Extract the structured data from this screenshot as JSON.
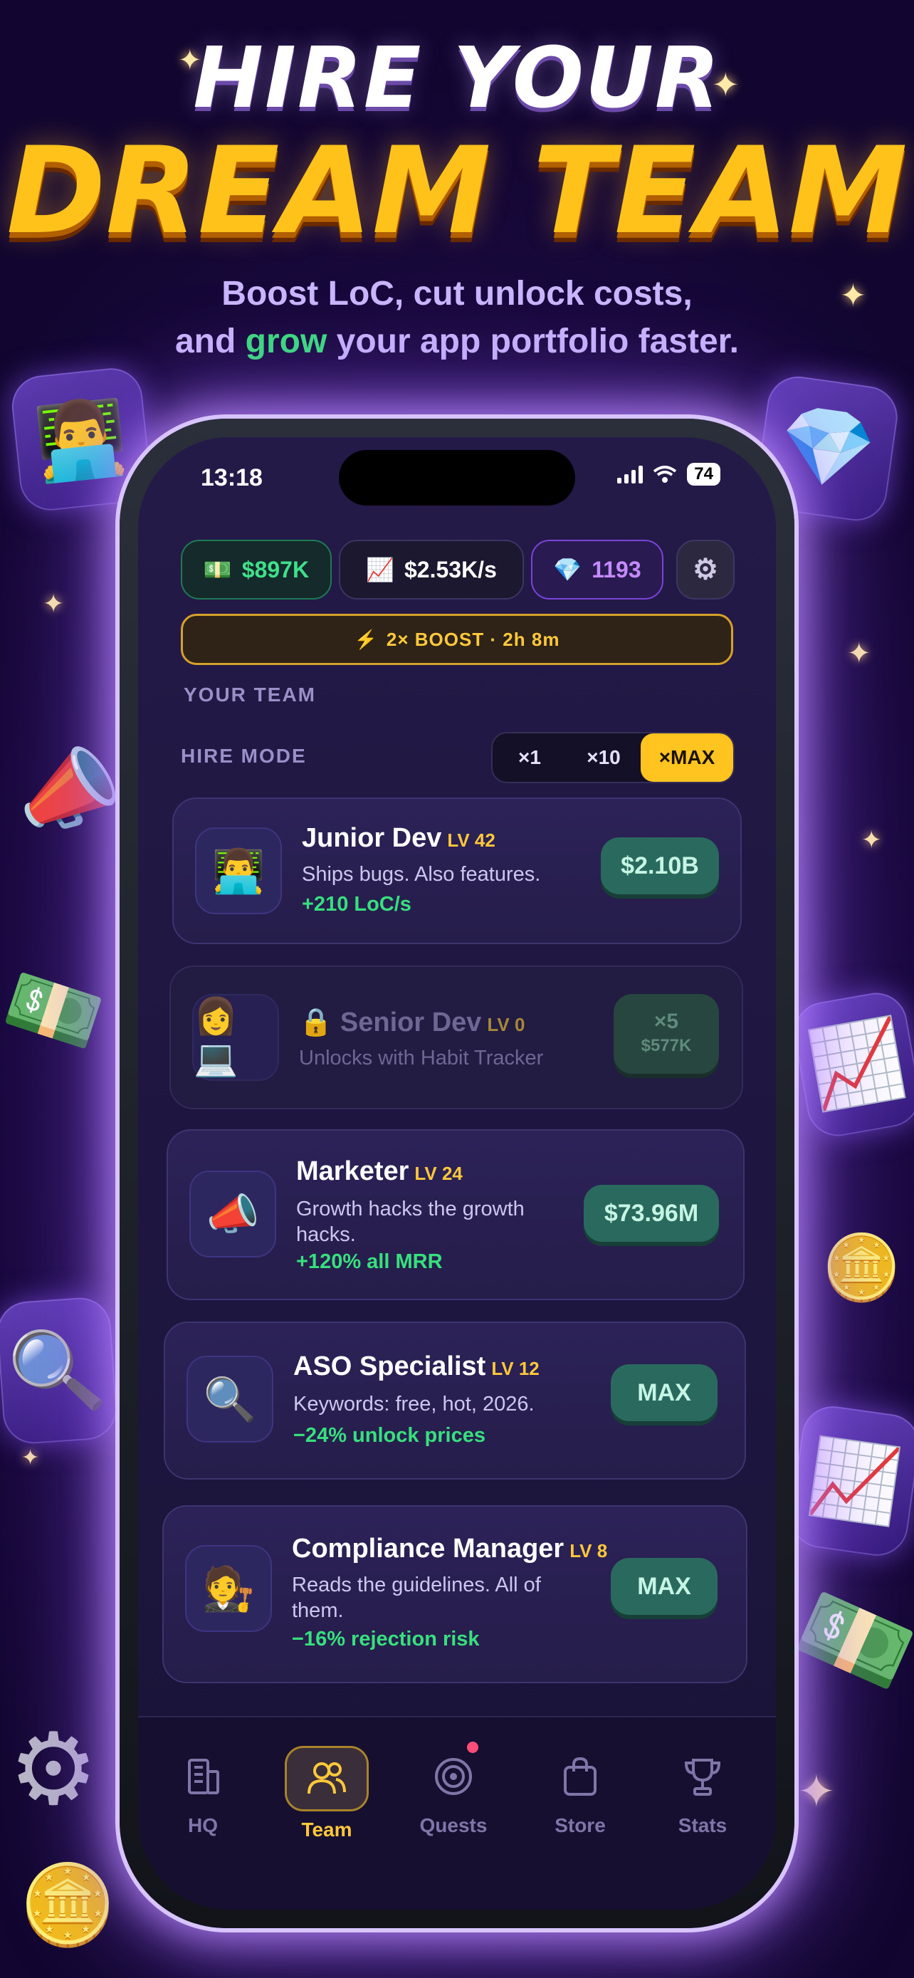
{
  "hero": {
    "line1": "HIRE YOUR",
    "line2": "DREAM TEAM",
    "subtitle_line1": "Boost LoC, cut unlock costs,",
    "subtitle_and": "and ",
    "subtitle_grow": "grow",
    "subtitle_rest": " your app portfolio faster."
  },
  "status": {
    "time": "13:18",
    "battery": "74"
  },
  "stats": {
    "cash_icon": "💵",
    "cash": "$897K",
    "rate_icon": "📈",
    "rate": "$2.53K/s",
    "gems_icon": "💎",
    "gems": "1193",
    "settings_icon": "gear-icon"
  },
  "boost": {
    "icon": "⚡",
    "label": "2× BOOST · 2h 8m"
  },
  "team": {
    "section_label": "YOUR TEAM",
    "hire_mode_label": "HIRE MODE",
    "modes": [
      "×1",
      "×10",
      "×MAX"
    ],
    "active_mode": "×MAX"
  },
  "members": [
    {
      "avatar": "👨‍💻",
      "name": "Junior Dev",
      "level": "LV 42",
      "desc": "Ships bugs. Also features.",
      "effect": "+210 LoC/s",
      "button": "$2.10B"
    },
    {
      "avatar": "👩💻",
      "lock_icon": "🔒",
      "name": "Senior Dev",
      "level": "LV 0",
      "desc": "Unlocks with Habit Tracker",
      "button_top": "×5",
      "button_bottom": "$577K",
      "locked": true
    },
    {
      "avatar": "📣",
      "name": "Marketer",
      "level": "LV 24",
      "desc": "Growth hacks the growth hacks.",
      "effect": "+120% all MRR",
      "button": "$73.96M"
    },
    {
      "avatar": "🔍",
      "name": "ASO Specialist",
      "level": "LV 12",
      "desc": "Keywords: free, hot, 2026.",
      "effect": "−24% unlock prices",
      "button": "MAX"
    },
    {
      "avatar": "🧑‍⚖️",
      "name": "Compliance Manager",
      "level": "LV 8",
      "desc": "Reads the guidelines. All of them.",
      "effect": "−16% rejection risk",
      "button": "MAX"
    }
  ],
  "tabs": [
    {
      "label": "HQ",
      "icon": "building-icon"
    },
    {
      "label": "Team",
      "icon": "people-icon",
      "active": true
    },
    {
      "label": "Quests",
      "icon": "target-icon",
      "badge": true
    },
    {
      "label": "Store",
      "icon": "bag-icon"
    },
    {
      "label": "Stats",
      "icon": "trophy-icon"
    }
  ],
  "decor": {
    "dev_tile": "👨‍💻",
    "diamond_tile": "💎",
    "megaphone": "📣",
    "cash": "💵",
    "chart_up": "📈",
    "coin": "🪙",
    "magnifier": "🔍",
    "chart_tile": "📈",
    "gear": "⚙"
  }
}
